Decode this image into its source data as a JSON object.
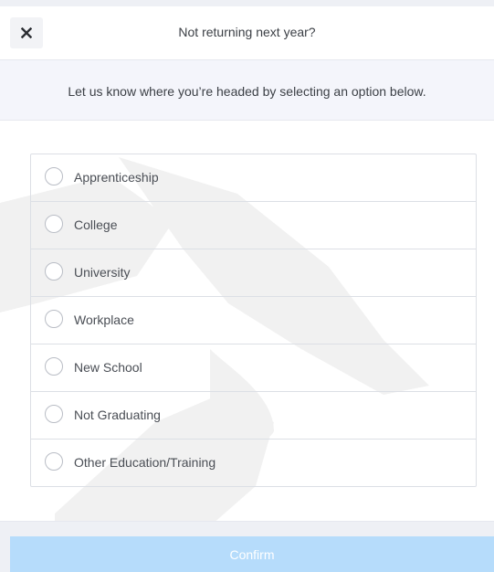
{
  "header": {
    "title": "Not returning next year?",
    "close_icon": "close-icon"
  },
  "instruction": "Let us know where you’re headed by selecting an option below.",
  "options": [
    {
      "label": "Apprenticeship",
      "selected": false
    },
    {
      "label": "College",
      "selected": false
    },
    {
      "label": "University",
      "selected": false
    },
    {
      "label": "Workplace",
      "selected": false
    },
    {
      "label": "New School",
      "selected": false
    },
    {
      "label": "Not Graduating",
      "selected": false
    },
    {
      "label": "Other Education/Training",
      "selected": false
    }
  ],
  "footer": {
    "confirm_label": "Confirm",
    "confirm_disabled": true
  },
  "colors": {
    "accent_disabled": "#b6dcfb",
    "subheader_bg": "#f4f5fb",
    "border": "#dcdfe5"
  }
}
